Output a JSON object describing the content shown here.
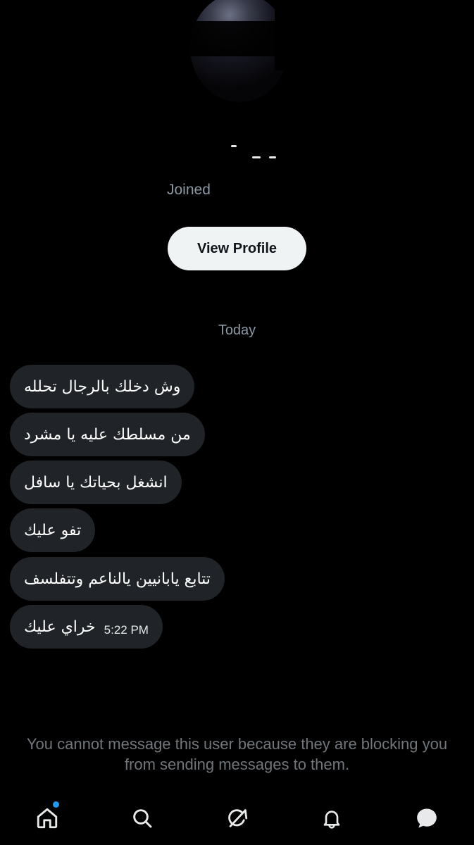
{
  "profile": {
    "joined_partial": "Joined",
    "view_profile_label": "View Profile"
  },
  "date_separator": "Today",
  "messages": [
    {
      "text": "وش دخلك بالرجال تحلله"
    },
    {
      "text": "من مسلطك عليه يا مشرد"
    },
    {
      "text": "انشغل بحياتك يا سافل"
    },
    {
      "text": "تفو عليك"
    },
    {
      "text": "تتابع يابانيين يالناعم وتتفلسف"
    },
    {
      "text": "خراي عليك",
      "time": "5:22 PM"
    }
  ],
  "notice": "You cannot message this user because they are blocking you from sending messages to them.",
  "tabbar": {
    "items": [
      {
        "icon": "home-icon",
        "has_badge": true
      },
      {
        "icon": "search-icon"
      },
      {
        "icon": "grok-icon"
      },
      {
        "icon": "bell-icon"
      },
      {
        "icon": "messages-icon",
        "active": true
      }
    ]
  },
  "colors": {
    "background": "#000000",
    "bubble": "#202327",
    "button_bg": "#eff3f4",
    "muted_text": "#71767b",
    "badge": "#1d9bf0"
  }
}
